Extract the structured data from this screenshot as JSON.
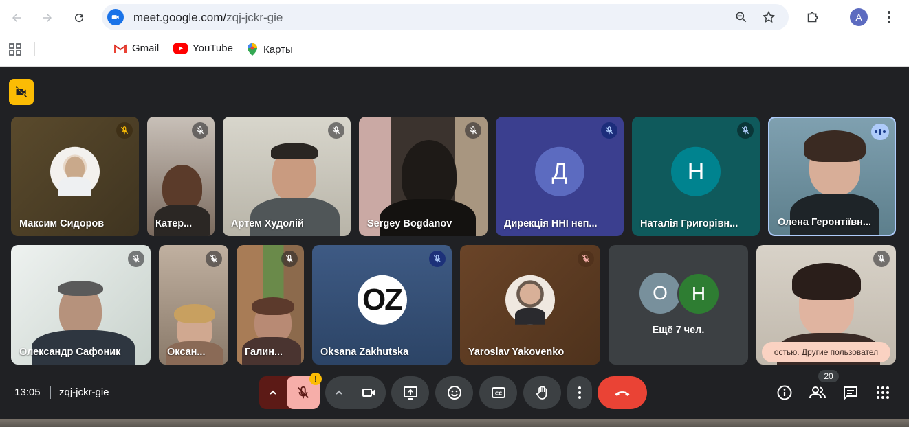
{
  "browser": {
    "url_host": "meet.google.com/",
    "url_path": "zqj-jckr-gie",
    "profile_initial": "A",
    "bookmarks": [
      {
        "label": "Gmail",
        "icon": "gmail-icon"
      },
      {
        "label": "YouTube",
        "icon": "youtube-icon"
      },
      {
        "label": "Карты",
        "icon": "maps-icon"
      }
    ]
  },
  "meeting": {
    "time": "13:05",
    "code": "zqj-jckr-gie",
    "participant_count": "20",
    "caption_text": "остью. Другие пользовател",
    "mic_alert": "!"
  },
  "tiles": [
    {
      "name": "Максим Сидоров",
      "avatar": ""
    },
    {
      "name": "Катер..."
    },
    {
      "name": "Артем Худолій"
    },
    {
      "name": "Sergey Bogdanov"
    },
    {
      "name": "Дирекція ННІ неп...",
      "avatar": "Д"
    },
    {
      "name": "Наталія Григорівн...",
      "avatar": "Н"
    },
    {
      "name": "Олена Геронтіївн..."
    },
    {
      "name": "Олександр Сафоник"
    },
    {
      "name": "Оксан..."
    },
    {
      "name": "Галин..."
    },
    {
      "name": "Oksana Zakhutska",
      "avatar": "OZ"
    },
    {
      "name": "Yaroslav Yakovenko"
    },
    {
      "name": "Ещё 7 чел.",
      "avatars": [
        "O",
        "Н"
      ]
    },
    {
      "name": ""
    }
  ],
  "colors": {
    "meet_bg": "#202124",
    "hangup": "#ea4335",
    "mic_muted_bg": "#f6aea9",
    "accent_yellow": "#fbbc04"
  }
}
